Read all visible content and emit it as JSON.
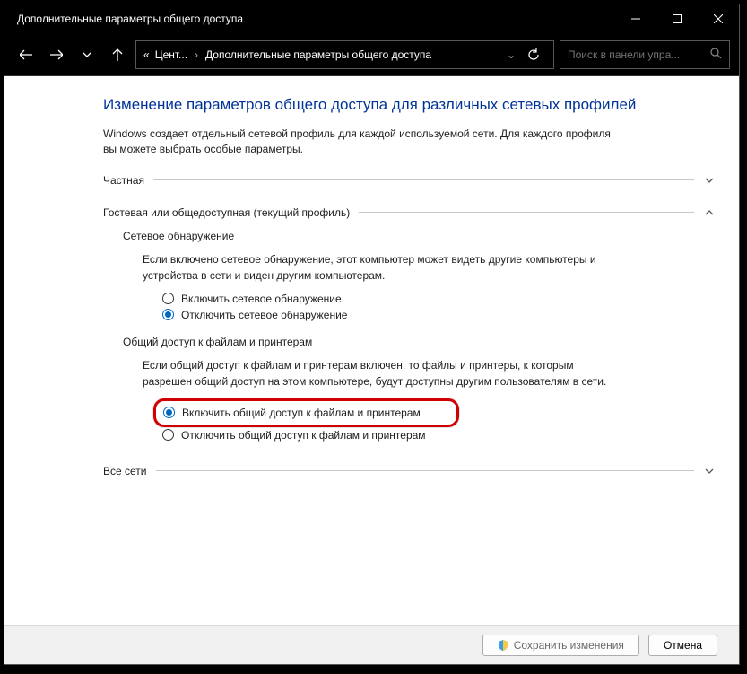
{
  "window": {
    "title": "Дополнительные параметры общего доступа"
  },
  "address": {
    "prefix": "«",
    "seg1": "Цент...",
    "seg2": "Дополнительные параметры общего доступа"
  },
  "search": {
    "placeholder": "Поиск в панели упра..."
  },
  "page": {
    "heading": "Изменение параметров общего доступа для различных сетевых профилей",
    "desc": "Windows создает отдельный сетевой профиль для каждой используемой сети. Для каждого профиля вы можете выбрать особые параметры."
  },
  "sections": {
    "private": {
      "label": "Частная"
    },
    "guest": {
      "label": "Гостевая или общедоступная (текущий профиль)",
      "netdisc": {
        "title": "Сетевое обнаружение",
        "desc": "Если включено сетевое обнаружение, этот компьютер может видеть другие компьютеры и устройства в сети и виден другим компьютерам.",
        "options": {
          "on": "Включить сетевое обнаружение",
          "off": "Отключить сетевое обнаружение"
        }
      },
      "fileshare": {
        "title": "Общий доступ к файлам и принтерам",
        "desc": "Если общий доступ к файлам и принтерам включен, то файлы и принтеры, к которым разрешен общий доступ на этом компьютере, будут доступны другим пользователям в сети.",
        "options": {
          "on": "Включить общий доступ к файлам и принтерам",
          "off": "Отключить общий доступ к файлам и принтерам"
        }
      }
    },
    "allnets": {
      "label": "Все сети"
    }
  },
  "bottom": {
    "save": "Сохранить изменения",
    "cancel": "Отмена"
  }
}
